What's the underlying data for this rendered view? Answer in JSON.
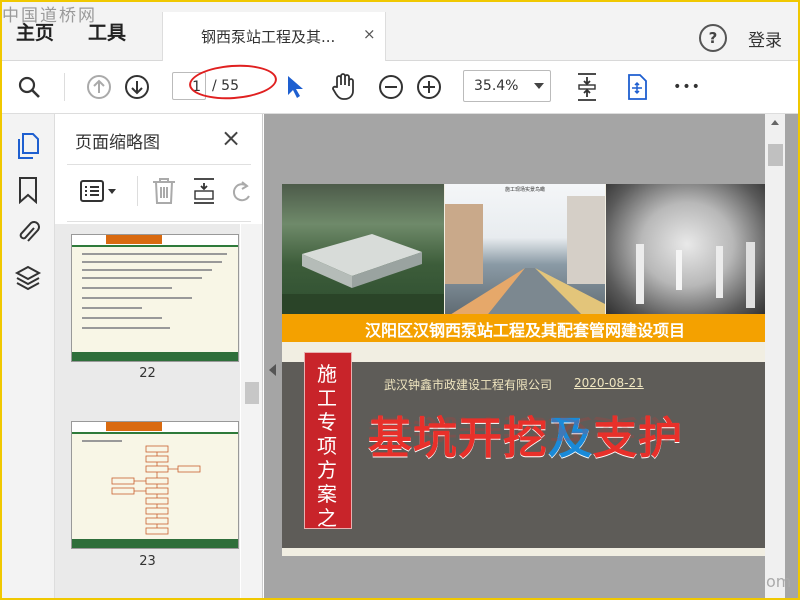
{
  "watermark": {
    "top": "中国道桥网",
    "bottom": "om"
  },
  "tabbar": {
    "home": "主页",
    "tools": "工具",
    "doc_title": "钢西泵站工程及其...",
    "close_glyph": "×",
    "help_glyph": "?",
    "login": "登录"
  },
  "toolbar": {
    "current_page": "1",
    "total_pages": "/ 55",
    "zoom": "35.4%",
    "more_glyph": "•••"
  },
  "thumbs": {
    "title": "页面缩略图",
    "close_glyph": "×",
    "items": [
      {
        "num": "22"
      },
      {
        "num": "23"
      }
    ]
  },
  "slide": {
    "photo_caption": "施工现场实景鸟瞰",
    "banner": "汉阳区汉钢西泵站工程及其配套管网建设项目",
    "ribbon": "施工专项方案之",
    "company": "武汉钟鑫市政建设工程有限公司",
    "date": "2020-08-21",
    "title_part1": "基坑开挖",
    "title_part2": "及",
    "title_part3": "支护"
  },
  "colors": {
    "accent_yellow": "#f0c800",
    "banner_orange": "#f4a100",
    "ribbon_red": "#c8242a",
    "title_red": "#e8302a",
    "title_blue": "#1a8ad8"
  }
}
